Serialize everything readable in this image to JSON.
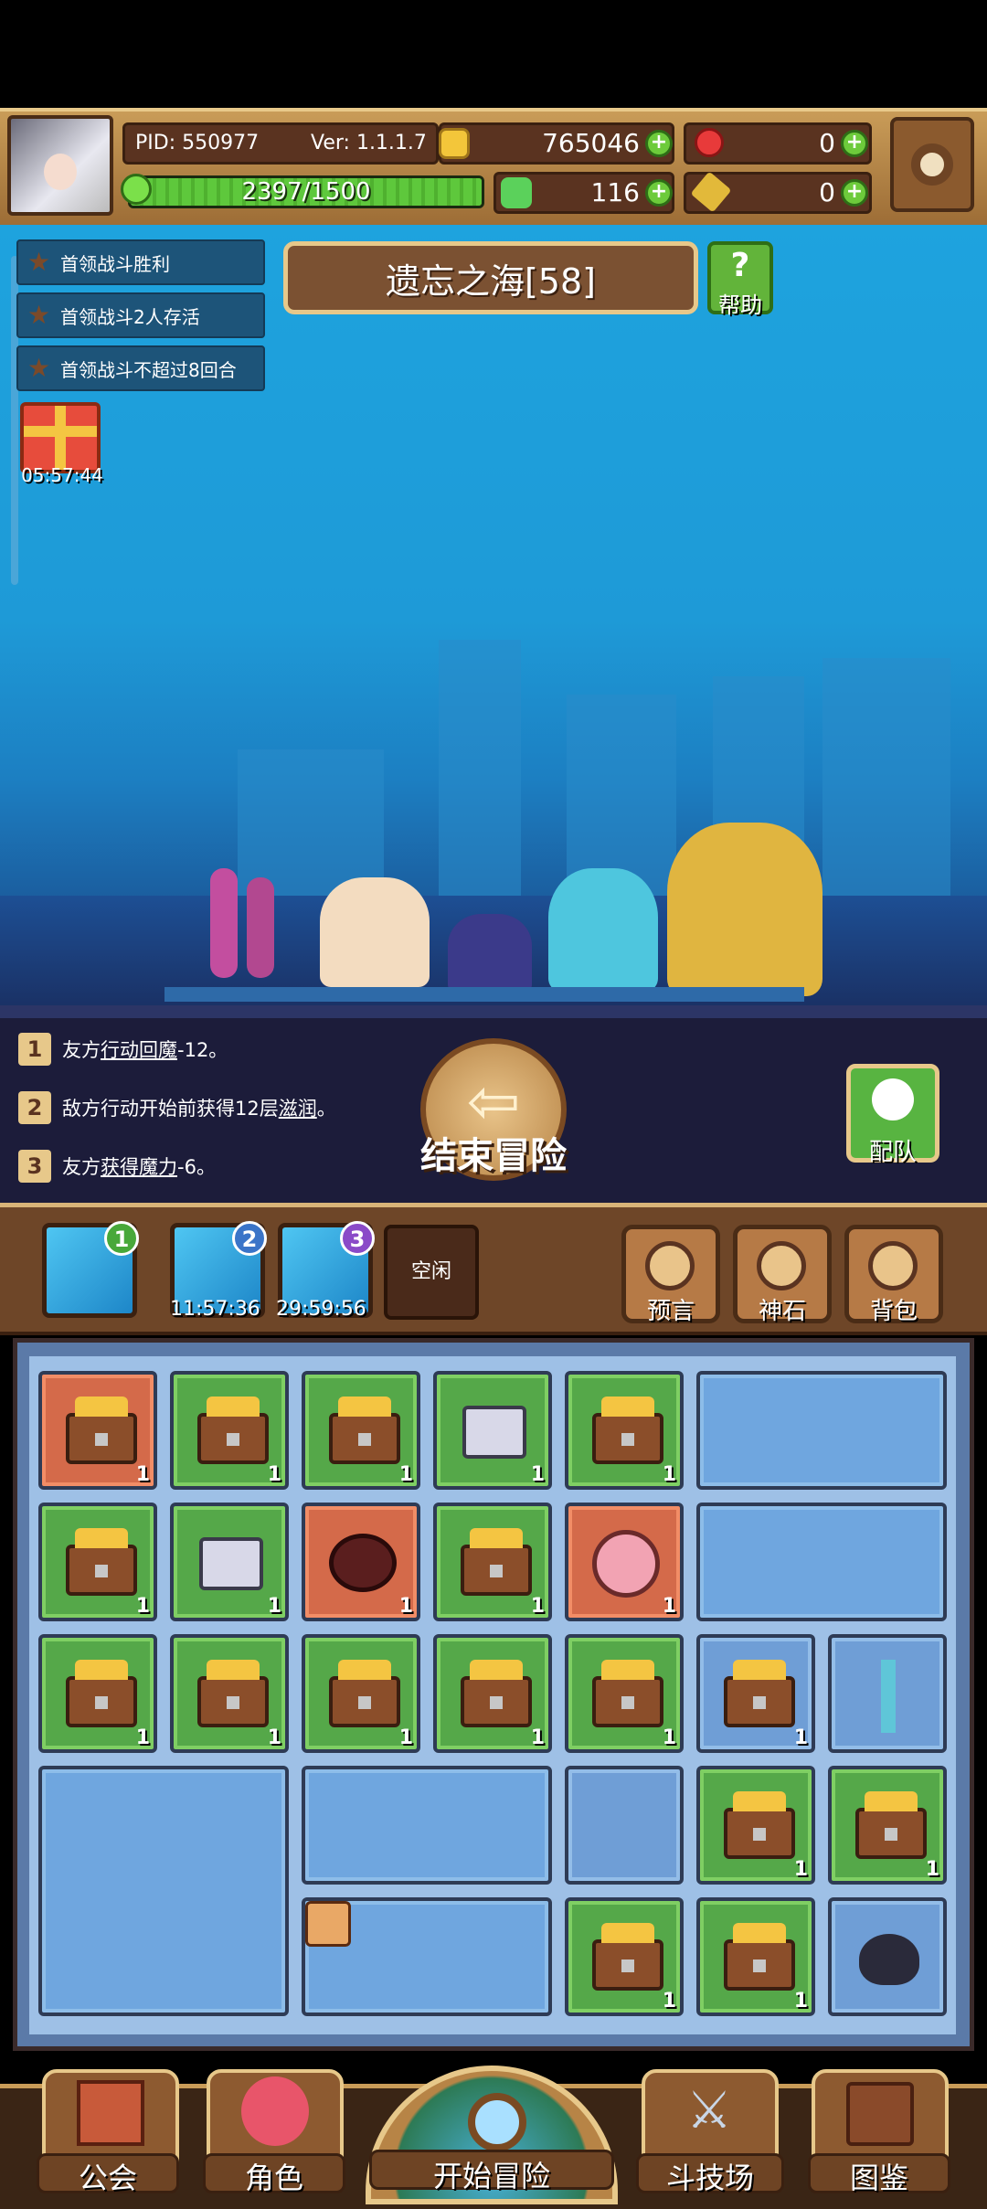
{
  "header": {
    "pid": "PID: 550977",
    "version": "Ver: 1.1.1.7",
    "gold": "765046",
    "rubies": "0",
    "energy": "2397/1500",
    "clovers": "116",
    "keys": "0"
  },
  "quests": [
    "首领战斗胜利",
    "首领战斗2人存活",
    "首领战斗不超过8回合"
  ],
  "gift_timer": "05:57:44",
  "area": {
    "title": "遗忘之海[58]",
    "help_label": "帮助",
    "help_icon": "?"
  },
  "battle_log": [
    {
      "num": "1",
      "pre": "友方",
      "link": "行动回魔",
      "post": "-12。"
    },
    {
      "num": "2",
      "pre": "敌方行动开始前获得12层",
      "link": "滋润",
      "post": "。"
    },
    {
      "num": "3",
      "pre": "友方",
      "link": "获得魔力",
      "post": "-6。"
    }
  ],
  "end_adventure_label": "结束冒险",
  "team_label": "配队",
  "slots": [
    {
      "badge": "1",
      "timer": ""
    },
    {
      "badge": "2",
      "timer": "11:57:36"
    },
    {
      "badge": "3",
      "timer": "29:59:56"
    }
  ],
  "idle_label": "空闲",
  "tools": {
    "prophecy": "预言",
    "godstone": "神石",
    "backpack": "背包"
  },
  "cell_count": "1",
  "nav": {
    "guild": "公会",
    "character": "角色",
    "start": "开始冒险",
    "arena": "斗技场",
    "codex": "图鉴"
  },
  "colors": {
    "sea": "#1ea3de",
    "green_cell": "#55a849",
    "red_cell": "#d46a4a",
    "blue_cell": "#6f9ed6",
    "frame_brown": "#6e4628",
    "gold": "#e7c88a"
  }
}
